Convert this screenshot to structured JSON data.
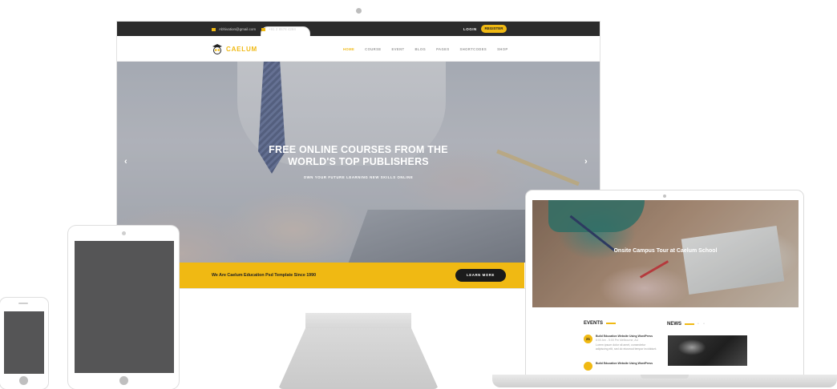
{
  "desktop": {
    "topbar": {
      "email": "Abhivation@gmail.com",
      "phone": "+91 2 8578 4284",
      "login_label": "LOGIN",
      "register_label": "REGISTER"
    },
    "logo": {
      "text": "CAELUM"
    },
    "nav": [
      {
        "label": "HOME",
        "active": true
      },
      {
        "label": "COURSE",
        "active": false
      },
      {
        "label": "EVENT",
        "active": false
      },
      {
        "label": "BLOG",
        "active": false
      },
      {
        "label": "PAGES",
        "active": false
      },
      {
        "label": "SHORTCODES",
        "active": false
      },
      {
        "label": "SHOP",
        "active": false
      }
    ],
    "hero": {
      "title_line1": "FREE ONLINE COURSES FROM THE",
      "title_line2": "WORLD'S TOP PUBLISHERS",
      "subtitle": "OWN YOUR FUTURE LEARNING NEW SKILLS ONLINE",
      "prev_icon": "chevron-left-icon",
      "next_icon": "chevron-right-icon"
    },
    "promo": {
      "text": "We Are Caelum Education Psd Template Since 1990",
      "button_label": "LEARN MORE"
    }
  },
  "laptop": {
    "hero_caption": "Onsite Campus Tour at Caelum School",
    "events_title": "EVENTS",
    "news_title": "NEWS",
    "events": [
      {
        "day": "21",
        "title": "Build Education Website Using WordPress",
        "meta": "8:00 Am - 5:00 Pm     Melbourne, AU",
        "body": "Lorem ipsum dolor sit amet, consectetur adipiscing elit, sed do eiusmod tempor incididunt."
      },
      {
        "day": "",
        "title": "Build Education Website Using WordPress",
        "meta": "",
        "body": ""
      }
    ]
  },
  "colors": {
    "accent": "#f0b913",
    "topbar_bg": "#2b2b2b",
    "device_screen_gray": "#555556"
  }
}
